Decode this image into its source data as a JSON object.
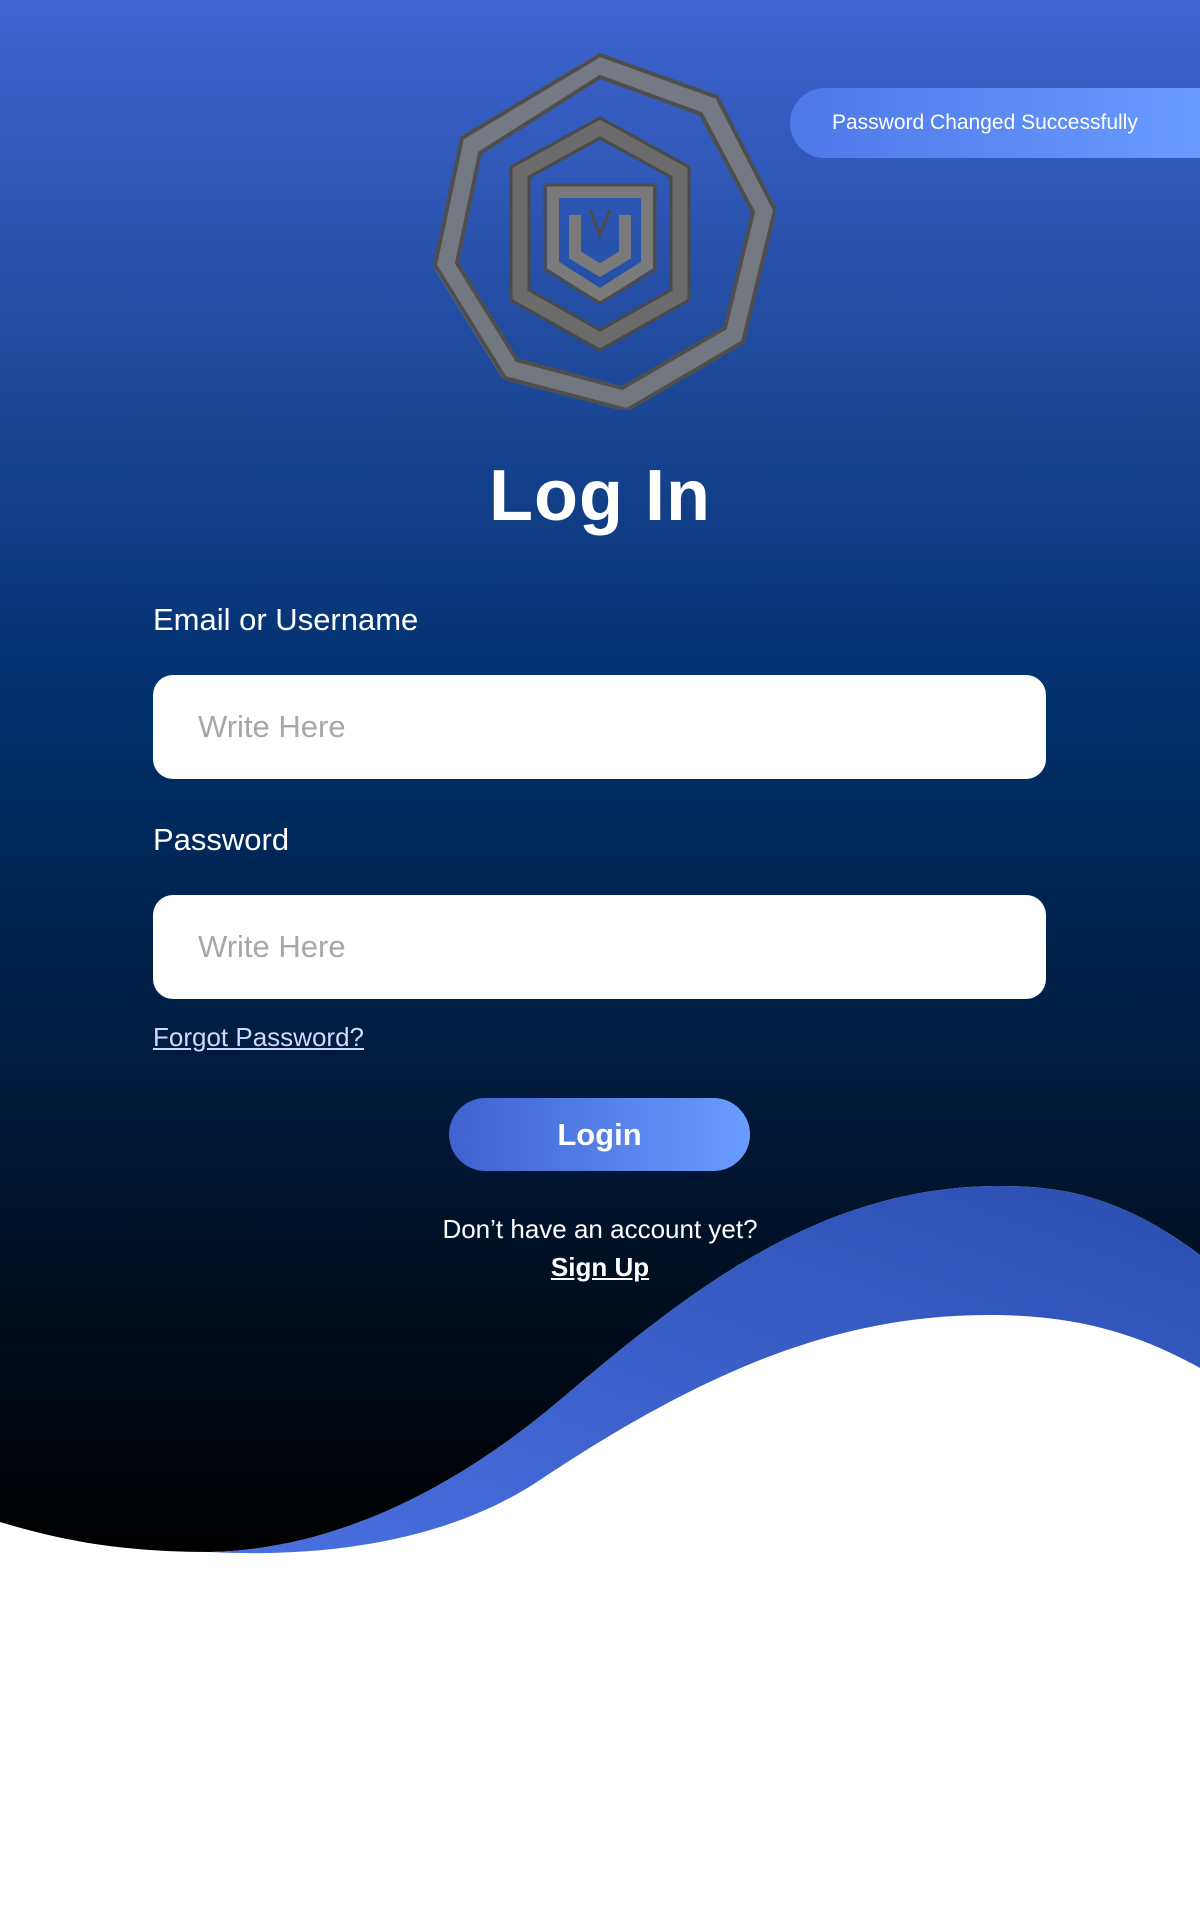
{
  "toast": {
    "text": "Password Changed Successfully"
  },
  "title": "Log In",
  "email": {
    "label": "Email or Username",
    "placeholder": "Write Here"
  },
  "password": {
    "label": "Password",
    "placeholder": "Write Here"
  },
  "forgot_password": "Forgot Password?",
  "login_button": "Login",
  "signup_prompt": "Don’t have an account yet?",
  "signup_link": "Sign Up",
  "colors": {
    "top": "#3e62cf",
    "mid": "#002f6c",
    "bottom": "#000000",
    "wave_accent": "#3457c4",
    "button_start": "#3e62cf",
    "button_end": "#6a9cff"
  },
  "logo": {
    "icon": "octagon-knot-logo"
  }
}
